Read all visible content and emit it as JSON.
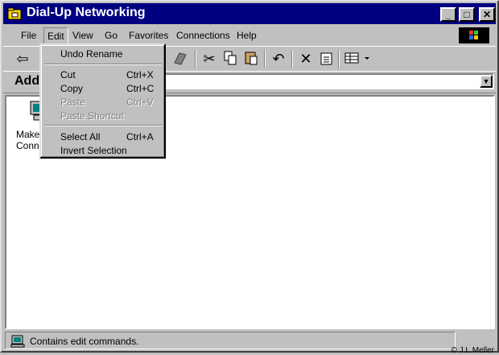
{
  "window": {
    "title": "Dial-Up Networking"
  },
  "title_buttons": {
    "minimize": "_",
    "maximize": "□",
    "close": "✕"
  },
  "menubar": {
    "items": [
      {
        "label": "File"
      },
      {
        "label": "Edit"
      },
      {
        "label": "View"
      },
      {
        "label": "Go"
      },
      {
        "label": "Favorites"
      },
      {
        "label": "Connections"
      },
      {
        "label": "Help"
      }
    ]
  },
  "toolbar": {
    "icons": [
      "back-icon",
      "dial-icon",
      "cut-icon",
      "copy-icon",
      "paste-icon",
      "undo-icon",
      "delete-icon",
      "properties-icon",
      "views-icon"
    ]
  },
  "address": {
    "label": "Addr",
    "value": ""
  },
  "content": {
    "items": [
      {
        "label": "Make New Connection"
      }
    ]
  },
  "edit_menu": {
    "items": [
      {
        "label": "Undo Rename",
        "shortcut": "",
        "enabled": true
      },
      {
        "label": "Cut",
        "shortcut": "Ctrl+X",
        "enabled": true
      },
      {
        "label": "Copy",
        "shortcut": "Ctrl+C",
        "enabled": true
      },
      {
        "label": "Paste",
        "shortcut": "Ctrl+V",
        "enabled": false
      },
      {
        "label": "Paste Shortcut",
        "shortcut": "",
        "enabled": false
      },
      {
        "label": "Select All",
        "shortcut": "Ctrl+A",
        "enabled": true
      },
      {
        "label": "Invert Selection",
        "shortcut": "",
        "enabled": true
      }
    ]
  },
  "status": {
    "text": "Contains edit commands.",
    "copyright": "© J.L.Meller"
  }
}
